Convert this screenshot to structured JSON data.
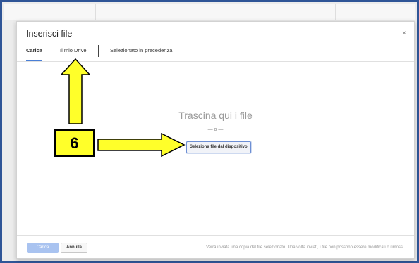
{
  "dialog": {
    "title": "Inserisci file",
    "close_icon": "close-icon",
    "close_glyph": "×",
    "tabs": [
      {
        "label": "Carica",
        "active": true
      },
      {
        "label": "Il mio Drive",
        "active": false
      },
      {
        "label": "Selezionato in precedenza",
        "active": false
      }
    ],
    "drop": {
      "title": "Trascina qui i file",
      "or": "— o —",
      "select_button": "Seleziona file dal dispositivo"
    },
    "footer": {
      "upload_button": "Carica",
      "cancel_button": "Annulla",
      "note": "Verrà inviata una copia del file selezionato. Una volta inviati, i file non possono essere modificati o rimossi."
    }
  },
  "annotation": {
    "step_number": "6",
    "color": "#ffff2a"
  }
}
